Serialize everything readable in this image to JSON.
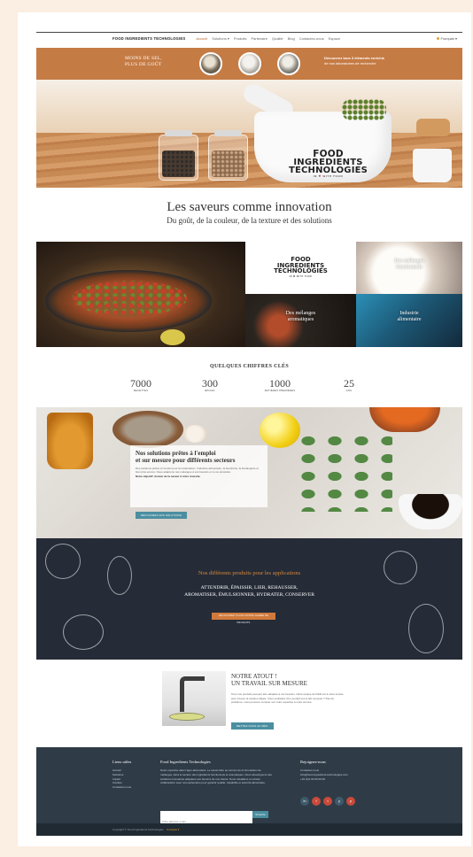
{
  "nav": {
    "brand": "FOOD INGREDIENTS TECHNOLOGIES",
    "items": [
      {
        "label": "Accueil",
        "active": true
      },
      {
        "label": "Solutions ▾",
        "active": false
      },
      {
        "label": "Produits",
        "active": false
      },
      {
        "label": "Partenaire",
        "active": false
      },
      {
        "label": "Qualité",
        "active": false
      },
      {
        "label": "Blog",
        "active": false
      },
      {
        "label": "Contactez-nous",
        "active": false
      },
      {
        "label": "Espace",
        "active": false
      }
    ],
    "language": "Français ▾"
  },
  "band": {
    "slogan_line1": "MOINS DE SEL,",
    "slogan_line2": "PLUS DE GOÛT",
    "promo_line1": "Découvrez tous 3 éléments enrichis",
    "promo_line2": "de nos laboratoires de recherche"
  },
  "hero": {
    "logo_line1": "FOOD",
    "logo_line2": "INGREDIENTS",
    "logo_line3": "TECHNOLOGIES",
    "logo_tag_a": "IN",
    "logo_tag_heart": "♥",
    "logo_tag_b": "WITH FOOD"
  },
  "headline": {
    "title": "Les saveurs comme innovation",
    "subtitle": "Du goût, de la couleur, de la texture et des solutions"
  },
  "mosaic": {
    "logo_line1": "FOOD",
    "logo_line2": "INGREDIENTS",
    "logo_line3": "TECHNOLOGIES",
    "logo_tag": "IN ♥ WITH FOOD",
    "tile_mix_line1": "Des mélanges",
    "tile_mix_line2": "fonctionnels",
    "tile_aroma_line1": "Des mélanges",
    "tile_aroma_line2": "aromatiques",
    "tile_indus_line1": "Industrie",
    "tile_indus_line2": "alimentaire"
  },
  "stats": {
    "title": "QUELQUES CHIFFRES CLÉS",
    "items": [
      {
        "num": "7000",
        "label": "RECETTES"
      },
      {
        "num": "300",
        "label": "ÉPICES"
      },
      {
        "num": "1000",
        "label": "MATIÈRES PREMIÈRES"
      },
      {
        "num": "25",
        "label": "ANS"
      }
    ]
  },
  "solutions": {
    "title_line1": "Nos solutions prêtes à l'emploi",
    "title_line2": "et sur mesure pour différents secteurs",
    "body": "Des solutions prêtes à l'emploi pour la restauration, l'industrie alimentaire, la boucherie, la boulangerie et bien plus encore. Nous adaptons nos mélanges à vos besoins et à vos procédés.",
    "strong": "Notre objectif: donner de la saveur à votre réussite.",
    "button": "DÉCOUVREZ NOS SOLUTIONS"
  },
  "applications": {
    "title": "Nos différents produits pour les applications",
    "line1": "ATTENDRIR, ÉPAISSIR, LIER, REHAUSSER,",
    "line2": "AROMATISER, ÉMULSIONNER, HYDRATER, CONSERVER",
    "button": "DÉCOUVREZ TOUTE NOTRE GAMME DE PRODUITS"
  },
  "atout": {
    "title_line1": "NOTRE ATOUT !",
    "title_line2": "UN TRAVAIL SUR MESURE",
    "body": "Tous nos produits peuvent être adaptés à vos besoins. Notre équipe de R&D est à votre écoute pour trouver la solution idéale. Vous souhaitez d'un produit tout à fait nouveau ? Pas de problème, nous pouvons compter sur notre expertise à votre service.",
    "button": "METTEZ-VOUS AU DÉFI"
  },
  "footer": {
    "col1_title": "Liens utiles",
    "col1_links": [
      "Accueil",
      "Solutions",
      "Impact",
      "Carrière",
      "Contactez-nous"
    ],
    "col2_title": "Food Ingredients Technologies",
    "col2_text": "Notre expertise dans l'agro-alimentaire. Le savoir-faire au service de la formulation de mélanges, dans le secteur des ingrédients fonctionnels et aromatiques. Nous développons des solutions innovantes adaptées aux besoins de nos clients. Nous travaillons en étroite collaboration avec nos partenaires pour garantir qualité, traçabilité et sécurité alimentaire.",
    "col3_title": "Rejoignez-nous",
    "col3_lines": [
      "Contactez-nous",
      "info@food-ingredients-technologies.com",
      "+33 (0)1 00 00 00 00"
    ],
    "search_placeholder": "Votre adresse email",
    "search_button": "S'inscrire",
    "socials": [
      "in",
      "f",
      "t",
      "y",
      "p"
    ],
    "copyright": "Copyright © Food Ingredients Technologies",
    "language": "Français ▾"
  },
  "colors": {
    "accent_orange": "#c57b44",
    "button_teal": "#4b8ea0",
    "dark_section": "#252b37",
    "footer": "#2f3c47"
  }
}
